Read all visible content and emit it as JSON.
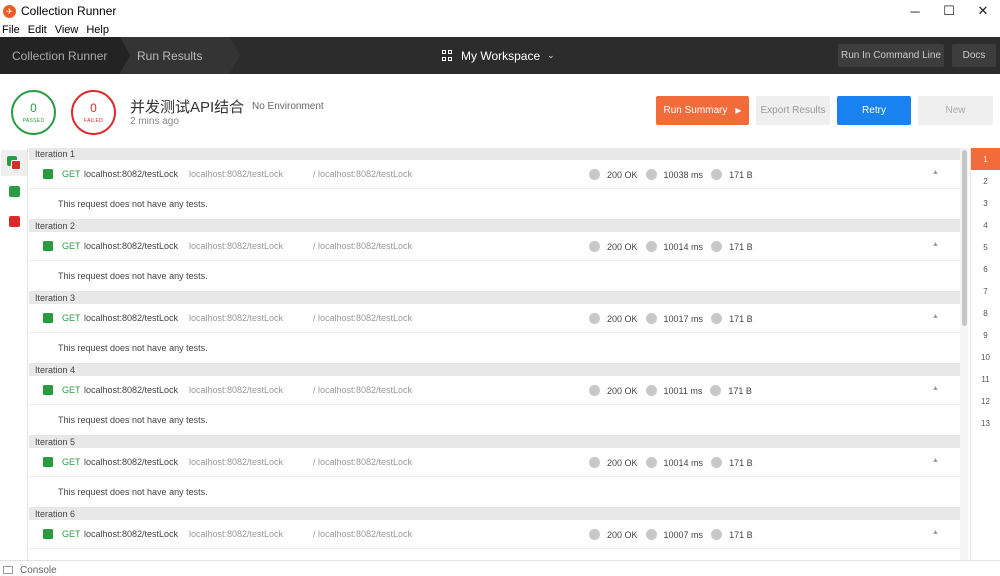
{
  "window": {
    "title": "Collection Runner",
    "logo_icon": "postman-logo-icon"
  },
  "menu": [
    "File",
    "Edit",
    "View",
    "Help"
  ],
  "nav": {
    "breadcrumbs": [
      "Collection Runner",
      "Run Results"
    ],
    "workspace": "My Workspace",
    "run_cmd_label": "Run In Command Line",
    "docs_label": "Docs"
  },
  "summary": {
    "passed_count": "0",
    "passed_label": "PASSED",
    "failed_count": "0",
    "failed_label": "FAILED",
    "collection_name": "并发测试API结合",
    "environment": "No Environment",
    "time_ago": "2 mins ago",
    "run_summary_label": "Run Summary",
    "export_label": "Export Results",
    "retry_label": "Retry",
    "new_label": "New"
  },
  "iterations": [
    {
      "title": "Iteration 1",
      "method": "GET",
      "name": "localhost:8082/testLock",
      "url": "localhost:8082/testLock",
      "path": "/ localhost:8082/testLock",
      "status": "200 OK",
      "time": "10038 ms",
      "size": "171 B",
      "note": "This request does not have any tests."
    },
    {
      "title": "Iteration 2",
      "method": "GET",
      "name": "localhost:8082/testLock",
      "url": "localhost:8082/testLock",
      "path": "/ localhost:8082/testLock",
      "status": "200 OK",
      "time": "10014 ms",
      "size": "171 B",
      "note": "This request does not have any tests."
    },
    {
      "title": "Iteration 3",
      "method": "GET",
      "name": "localhost:8082/testLock",
      "url": "localhost:8082/testLock",
      "path": "/ localhost:8082/testLock",
      "status": "200 OK",
      "time": "10017 ms",
      "size": "171 B",
      "note": "This request does not have any tests."
    },
    {
      "title": "Iteration 4",
      "method": "GET",
      "name": "localhost:8082/testLock",
      "url": "localhost:8082/testLock",
      "path": "/ localhost:8082/testLock",
      "status": "200 OK",
      "time": "10011 ms",
      "size": "171 B",
      "note": "This request does not have any tests."
    },
    {
      "title": "Iteration 5",
      "method": "GET",
      "name": "localhost:8082/testLock",
      "url": "localhost:8082/testLock",
      "path": "/ localhost:8082/testLock",
      "status": "200 OK",
      "time": "10014 ms",
      "size": "171 B",
      "note": "This request does not have any tests."
    },
    {
      "title": "Iteration 6",
      "method": "GET",
      "name": "localhost:8082/testLock",
      "url": "localhost:8082/testLock",
      "path": "/ localhost:8082/testLock",
      "status": "200 OK",
      "time": "10007 ms",
      "size": "171 B",
      "note": ""
    }
  ],
  "iteration_index": [
    "1",
    "2",
    "3",
    "4",
    "5",
    "6",
    "7",
    "8",
    "9",
    "10",
    "11",
    "12",
    "13"
  ],
  "active_iteration": "1",
  "status_bar": {
    "console_label": "Console"
  },
  "colors": {
    "accent": "#f26b3a",
    "pass": "#2a9d44",
    "fail": "#d92b2b",
    "primary": "#1a82f0",
    "nav_bg": "#2c2c2c"
  }
}
